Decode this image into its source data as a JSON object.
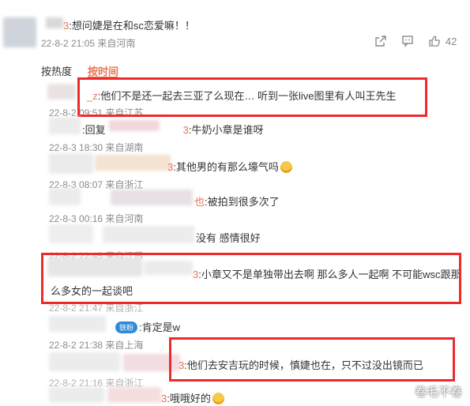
{
  "top_comment": {
    "username_tail": "3",
    "text": ":想问婕是在和sc恋爱嘛！！",
    "meta": "22-8-2 21:05 来自河南",
    "like_count": "42"
  },
  "sort_tabs": {
    "by_hot": "按热度",
    "by_time": "按时间"
  },
  "replies": [
    {
      "user_tail": "_z",
      "text": ":他们不是还一起去三亚了么现在… 听到一张live图里有人叫王先生",
      "meta": "22-8-2 09:51 来自江苏"
    },
    {
      "user_prefix": ":回复",
      "user_tail": "3",
      "text": ":牛奶小章是谁呀",
      "meta": "22-8-3 18:30 来自湖南"
    },
    {
      "user_tail": "3",
      "text": ":其他男的有那么壕气吗",
      "meta": "22-8-3 08:07 来自浙江"
    },
    {
      "user_tail": "也",
      "text": ":被拍到很多次了",
      "meta": "22-8-3 00:16 来自河南"
    },
    {
      "user_tail": "",
      "text": "没有 感情很好",
      "meta": "22-8-2 22:45 来自江苏"
    },
    {
      "user_tail": "3",
      "text_line1": ":小章又不是单独带出去啊 那么多人一起啊 不可能wsc跟那",
      "text_line2": "么多女的一起谈吧",
      "meta": "22-8-2 21:47 来自浙江"
    },
    {
      "badge": "铁粉",
      "text": ":肯定是w",
      "meta": "22-8-2 21:38 来自上海"
    },
    {
      "user_tail": "3",
      "text": ":他们去安吉玩的时候，慎婕也在，只不过没出镜而已",
      "meta": "22-8-2 21:16 来自浙江"
    },
    {
      "user_tail": "3",
      "text": ":哦哦好的"
    }
  ],
  "watermark": "卷毛不卷",
  "colors": {
    "accent": "#eb7350",
    "highlight_box": "#ee2a2a",
    "meta": "#8a8a8a"
  }
}
